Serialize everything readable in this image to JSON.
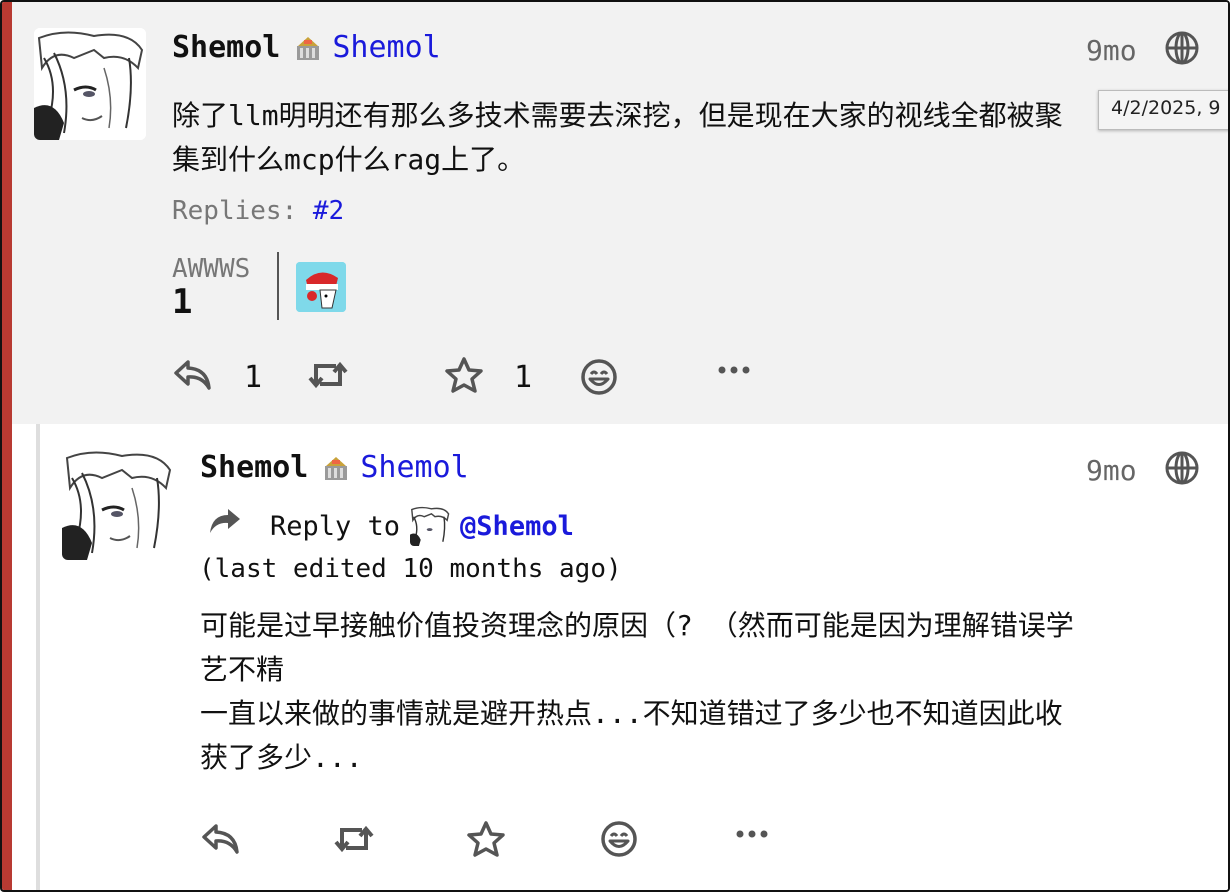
{
  "posts": [
    {
      "author": "Shemol",
      "instance_name": "Shemol",
      "time": "9mo",
      "tooltip": "4/2/2025, 9",
      "content_lines": [
        "除了llm明明还有那么多技术需要去深挖，但是现在大家的视线全都被聚",
        "集到什么mcp什么rag上了。"
      ],
      "replies_label": "Replies:",
      "replies_link": "#2",
      "reaction": {
        "label": "AWWWS",
        "count": "1"
      },
      "actions": {
        "reply_count": "1",
        "favorite_count": "1"
      }
    },
    {
      "author": "Shemol",
      "instance_name": "Shemol",
      "time": "9mo",
      "reply_to_label": "Reply to",
      "reply_to_user": "@Shemol",
      "edited": "(last edited 10 months ago)",
      "content_lines": [
        "可能是过早接触价值投资理念的原因（? （然而可能是因为理解错误学",
        "艺不精",
        "一直以来做的事情就是避开热点...不知道错过了多少也不知道因此收",
        "获了多少..."
      ]
    }
  ],
  "icons": [
    "reply-icon",
    "boost-icon",
    "star-icon",
    "emoji-icon",
    "more-icon",
    "globe-icon",
    "instance-icon",
    "reply-arrow-icon"
  ]
}
